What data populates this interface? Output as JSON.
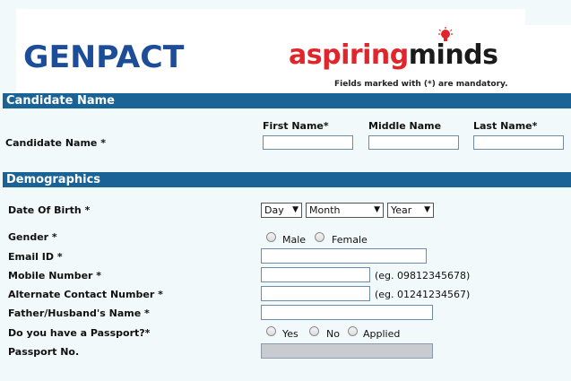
{
  "header": {
    "logo_left": "GENPACT",
    "logo_right_part1": "aspiring",
    "logo_right_part2": "minds",
    "mandatory_note": "Fields marked with (*) are mandatory."
  },
  "colors": {
    "section_bar": "#1a6396",
    "genpact_blue": "#1d4d99",
    "aspiring_red": "#e0252b"
  },
  "candidate_section": {
    "title": "Candidate Name",
    "field_label": "Candidate Name *",
    "first_name_header": "First Name*",
    "middle_name_header": "Middle Name",
    "last_name_header": "Last Name*",
    "first_name_value": "",
    "middle_name_value": "",
    "last_name_value": ""
  },
  "demographics": {
    "title": "Demographics",
    "dob_label": "Date Of Birth *",
    "dob_day": "Day",
    "dob_month": "Month",
    "dob_year": "Year",
    "gender_label": "Gender *",
    "gender_male": "Male",
    "gender_female": "Female",
    "email_label": "Email ID *",
    "email_value": "",
    "mobile_label": "Mobile Number *",
    "mobile_value": "",
    "mobile_hint": "(eg. 09812345678)",
    "alt_label": "Alternate Contact Number *",
    "alt_value": "",
    "alt_hint": "(eg. 01241234567)",
    "father_label": "Father/Husband's Name *",
    "father_value": "",
    "passport_q_label": "Do you have a Passport?*",
    "passport_yes": "Yes",
    "passport_no": "No",
    "passport_applied": "Applied",
    "passport_no_label": "Passport No.",
    "passport_no_value": ""
  }
}
